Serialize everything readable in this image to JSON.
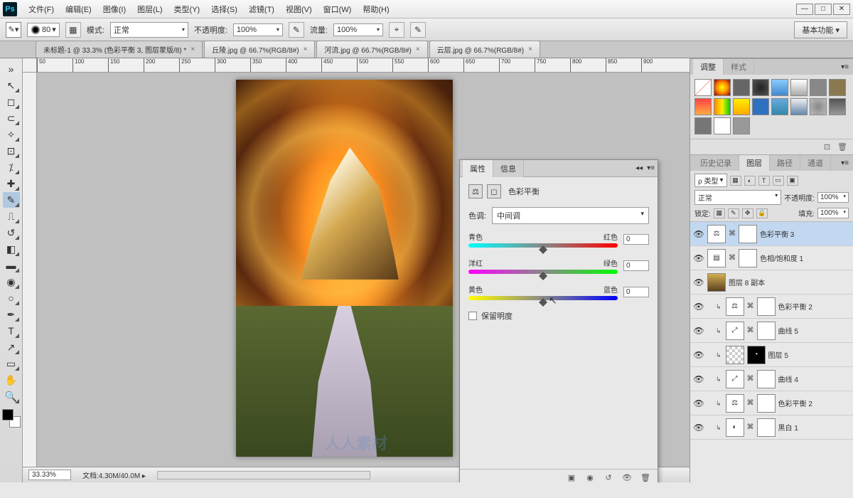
{
  "app": {
    "icon": "Ps"
  },
  "menu": [
    "文件(F)",
    "编辑(E)",
    "图像(I)",
    "图层(L)",
    "类型(Y)",
    "选择(S)",
    "滤镜(T)",
    "视图(V)",
    "窗口(W)",
    "帮助(H)"
  ],
  "options": {
    "brushSize": "80",
    "modeLabel": "模式:",
    "mode": "正常",
    "opacityLabel": "不透明度:",
    "opacity": "100%",
    "flowLabel": "流量:",
    "flow": "100%",
    "workspace": "基本功能"
  },
  "tabs": [
    "未标题-1 @ 33.3% (色彩平衡 3, 图层蒙版/8) *",
    "丘陵.jpg @ 66.7%(RGB/8#)",
    "河流.jpg @ 66.7%(RGB/8#)",
    "云层.jpg @ 66.7%(RGB/8#)"
  ],
  "ruler": [
    "50",
    "100",
    "150",
    "200",
    "250",
    "300",
    "350",
    "400",
    "450",
    "500",
    "550",
    "600",
    "650",
    "700",
    "750",
    "800",
    "850",
    "900"
  ],
  "status": {
    "zoom": "33.33%",
    "docLabel": "文档:",
    "doc": "4.30M/40.0M"
  },
  "panels": {
    "adjTabs": [
      "调整",
      "样式"
    ],
    "histTabs": [
      "历史记录",
      "图层",
      "路径",
      "通道"
    ]
  },
  "layerOpts": {
    "filterLabel": "ρ 类型",
    "blend": "正常",
    "opacityLabel": "不透明度:",
    "opacity": "100%",
    "lockLabel": "锁定:",
    "fillLabel": "填充:",
    "fill": "100%"
  },
  "layers": [
    {
      "name": "色彩平衡 3",
      "type": "adj",
      "icon": "⚖",
      "sel": true
    },
    {
      "name": "色相/饱和度 1",
      "type": "adj",
      "icon": "▤"
    },
    {
      "name": "图层 8 副本",
      "type": "img"
    },
    {
      "name": "色彩平衡 2",
      "type": "adj",
      "icon": "⚖",
      "nested": true
    },
    {
      "name": "曲线 5",
      "type": "adj",
      "icon": "⤢",
      "nested": true
    },
    {
      "name": "图层 5",
      "type": "smart",
      "nested": true
    },
    {
      "name": "曲线 4",
      "type": "adj",
      "icon": "⤢",
      "nested": true
    },
    {
      "name": "色彩平衡 2",
      "type": "adj",
      "icon": "⚖",
      "nested": true
    },
    {
      "name": "黑白 1",
      "type": "adj",
      "icon": "◐",
      "nested": true
    }
  ],
  "props": {
    "tabs": [
      "属性",
      "信息"
    ],
    "title": "色彩平衡",
    "toneLabel": "色调:",
    "tone": "中间调",
    "sliders": [
      {
        "left": "青色",
        "right": "红色",
        "val": "0",
        "grad": "gr-cr"
      },
      {
        "left": "洋红",
        "right": "绿色",
        "val": "0",
        "grad": "gr-mg"
      },
      {
        "left": "黄色",
        "right": "蓝色",
        "val": "0",
        "grad": "gr-yb"
      }
    ],
    "preserve": "保留明度"
  },
  "watermark": "人人素材"
}
